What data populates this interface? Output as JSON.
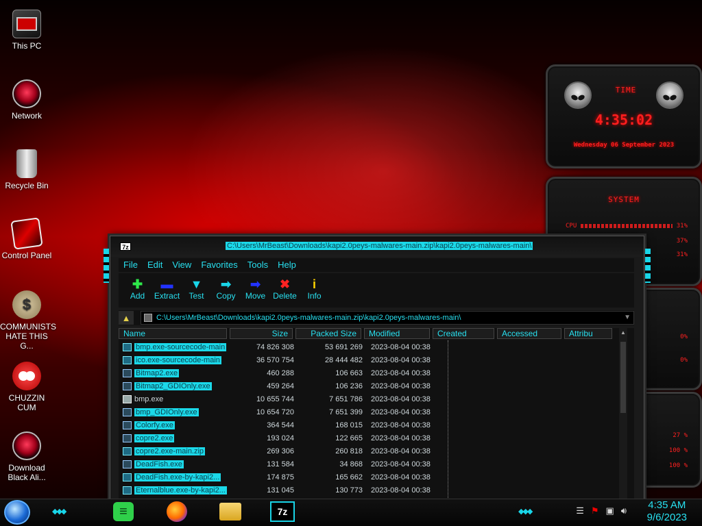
{
  "desktop": {
    "icons": [
      {
        "label": "This PC"
      },
      {
        "label": "Network"
      },
      {
        "label": "Recycle Bin"
      },
      {
        "label": "Control Panel"
      },
      {
        "label": "COMMUNISTS HATE THIS G..."
      },
      {
        "label": "CHUZZIN CUM"
      },
      {
        "label": "Download Black Ali..."
      }
    ]
  },
  "widget": {
    "time_title": "TIME",
    "clock": "4:35:02",
    "date": "Wednesday 06 September 2023",
    "system_title": "SYSTEM",
    "rows": [
      {
        "label": "CPU",
        "value": "31%"
      },
      {
        "label": "",
        "value": "37%"
      },
      {
        "label": "",
        "value": "31%"
      },
      {
        "label": "",
        "value": "0%"
      },
      {
        "label": "",
        "value": "0%"
      },
      {
        "label": "",
        "value": "27 %"
      },
      {
        "label": "",
        "value": "100 %"
      },
      {
        "label": "",
        "value": "100 %"
      }
    ]
  },
  "window": {
    "title": "C:\\Users\\MrBeast\\Downloads\\kapi2.0peys-malwares-main.zip\\kapi2.0peys-malwares-main\\",
    "menu": [
      "File",
      "Edit",
      "View",
      "Favorites",
      "Tools",
      "Help"
    ],
    "toolbar": [
      {
        "label": "Add",
        "icon": "plus-icon",
        "color": "#2ee84a"
      },
      {
        "label": "Extract",
        "icon": "minus-icon",
        "color": "#2233ff"
      },
      {
        "label": "Test",
        "icon": "check-icon",
        "color": "#19d5e8"
      },
      {
        "label": "Copy",
        "icon": "copy-arrow-icon",
        "color": "#19d5e8"
      },
      {
        "label": "Move",
        "icon": "move-arrow-icon",
        "color": "#2233ff"
      },
      {
        "label": "Delete",
        "icon": "x-icon",
        "color": "#ff2222"
      },
      {
        "label": "Info",
        "icon": "info-icon",
        "color": "#ffd400"
      }
    ],
    "address": "C:\\Users\\MrBeast\\Downloads\\kapi2.0peys-malwares-main.zip\\kapi2.0peys-malwares-main\\",
    "columns": [
      "Name",
      "Size",
      "Packed Size",
      "Modified",
      "Created",
      "Accessed",
      "Attribu"
    ],
    "files": [
      {
        "name": "bmp.exe-sourcecode-main",
        "size": "74 826 308",
        "packed": "53 691 269",
        "modified": "2023-08-04 00:38",
        "type": "folder"
      },
      {
        "name": "ico.exe-sourcecode-main",
        "size": "36 570 754",
        "packed": "28 444 482",
        "modified": "2023-08-04 00:38",
        "type": "folder"
      },
      {
        "name": "Bitmap2.exe",
        "size": "460 288",
        "packed": "106 663",
        "modified": "2023-08-04 00:38",
        "type": "exe"
      },
      {
        "name": "Bitmap2_GDIOnly.exe",
        "size": "459 264",
        "packed": "106 236",
        "modified": "2023-08-04 00:38",
        "type": "exe"
      },
      {
        "name": "bmp.exe",
        "size": "10 655 744",
        "packed": "7 651 786",
        "modified": "2023-08-04 00:38",
        "type": "exe-white"
      },
      {
        "name": "bmp_GDIOnly.exe",
        "size": "10 654 720",
        "packed": "7 651 399",
        "modified": "2023-08-04 00:38",
        "type": "exe"
      },
      {
        "name": "Colorfy.exe",
        "size": "364 544",
        "packed": "168 015",
        "modified": "2023-08-04 00:38",
        "type": "exe"
      },
      {
        "name": "copre2.exe",
        "size": "193 024",
        "packed": "122 665",
        "modified": "2023-08-04 00:38",
        "type": "exe"
      },
      {
        "name": "copre2.exe-main.zip",
        "size": "269 306",
        "packed": "260 818",
        "modified": "2023-08-04 00:38",
        "type": "zip"
      },
      {
        "name": "DeadFish.exe",
        "size": "131 584",
        "packed": "34 868",
        "modified": "2023-08-04 00:38",
        "type": "exe"
      },
      {
        "name": "DeadFish.exe-by-kapi2...",
        "size": "174 875",
        "packed": "165 662",
        "modified": "2023-08-04 00:38",
        "type": "zip"
      },
      {
        "name": "Eternalblue.exe-by-kapi2...",
        "size": "131 045",
        "packed": "130 773",
        "modified": "2023-08-04 00:38",
        "type": "zip"
      }
    ]
  },
  "taskbar": {
    "apps": [
      "green-notes-icon",
      "firefox-icon",
      "file-explorer-icon",
      "7zip-icon"
    ],
    "time": "4:35 AM",
    "date": "9/6/2023"
  }
}
